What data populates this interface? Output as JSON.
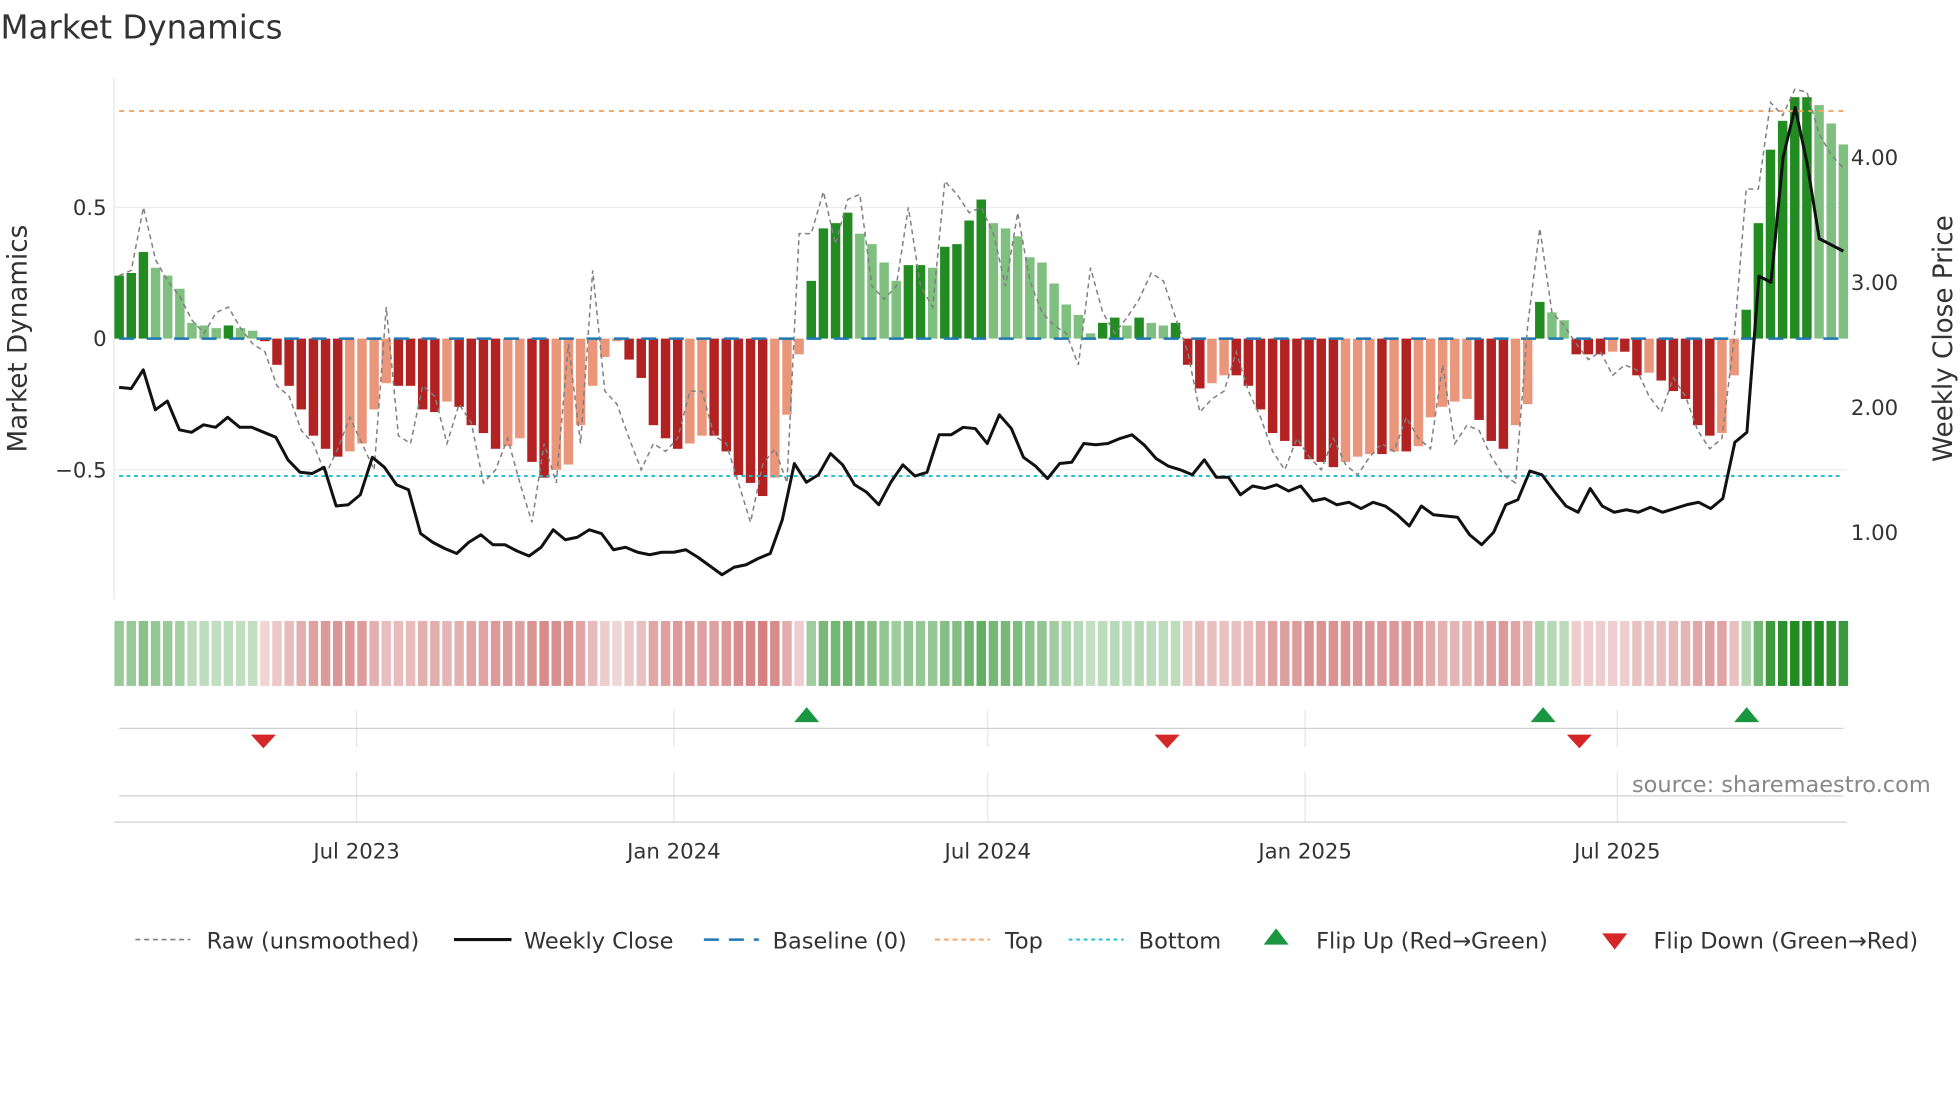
{
  "chart_data": {
    "type": "bar",
    "title": "Market Dynamics",
    "ylabel": "Market Dynamics",
    "y2label": "Weekly Close Price",
    "ylim": [
      -0.99,
      0.99
    ],
    "y2lim": [
      0.55,
      4.7
    ],
    "yticks": [
      {
        "v": 0.5,
        "label": "0.5"
      },
      {
        "v": 0,
        "label": "0"
      },
      {
        "v": -0.5,
        "label": "−0.5"
      }
    ],
    "y2ticks": [
      {
        "v": 4,
        "label": "4.00"
      },
      {
        "v": 3,
        "label": "3.00"
      },
      {
        "v": 2,
        "label": "2.00"
      },
      {
        "v": 1,
        "label": "1.00"
      }
    ],
    "x_start": "2023-02-13",
    "x_end": "2025-11-10",
    "xticks": [
      {
        "date": "2023-07-01",
        "label": "Jul 2023"
      },
      {
        "date": "2024-01-01",
        "label": "Jan 2024"
      },
      {
        "date": "2024-07-01",
        "label": "Jul 2024"
      },
      {
        "date": "2025-01-01",
        "label": "Jan 2025"
      },
      {
        "date": "2025-07-01",
        "label": "Jul 2025"
      }
    ],
    "levels": {
      "top": 0.867,
      "bottom": -0.524,
      "baseline": 0
    },
    "dynamics": [
      0.24,
      0.25,
      0.33,
      0.27,
      0.24,
      0.19,
      0.06,
      0.05,
      0.04,
      0.05,
      0.04,
      0.03,
      -0.01,
      -0.1,
      -0.18,
      -0.27,
      -0.37,
      -0.42,
      -0.45,
      -0.43,
      -0.4,
      -0.27,
      -0.17,
      -0.18,
      -0.18,
      -0.27,
      -0.28,
      -0.24,
      -0.26,
      -0.33,
      -0.36,
      -0.42,
      -0.41,
      -0.38,
      -0.47,
      -0.53,
      -0.5,
      -0.48,
      -0.33,
      -0.18,
      -0.07,
      -0.01,
      -0.08,
      -0.15,
      -0.33,
      -0.38,
      -0.42,
      -0.4,
      -0.37,
      -0.37,
      -0.43,
      -0.52,
      -0.55,
      -0.6,
      -0.53,
      -0.29,
      -0.06,
      0.22,
      0.42,
      0.44,
      0.48,
      0.4,
      0.36,
      0.29,
      0.22,
      0.28,
      0.28,
      0.27,
      0.35,
      0.36,
      0.45,
      0.53,
      0.44,
      0.42,
      0.39,
      0.31,
      0.29,
      0.21,
      0.13,
      0.09,
      0.02,
      0.06,
      0.08,
      0.05,
      0.08,
      0.06,
      0.05,
      0.06,
      -0.1,
      -0.19,
      -0.17,
      -0.14,
      -0.14,
      -0.18,
      -0.27,
      -0.36,
      -0.39,
      -0.41,
      -0.46,
      -0.47,
      -0.49,
      -0.47,
      -0.45,
      -0.44,
      -0.44,
      -0.43,
      -0.43,
      -0.41,
      -0.3,
      -0.26,
      -0.24,
      -0.23,
      -0.31,
      -0.39,
      -0.42,
      -0.33,
      -0.25,
      0.14,
      0.1,
      0.07,
      -0.06,
      -0.06,
      -0.06,
      -0.05,
      -0.05,
      -0.14,
      -0.13,
      -0.16,
      -0.2,
      -0.23,
      -0.33,
      -0.37,
      -0.36,
      -0.14,
      0.11,
      0.44,
      0.72,
      0.83,
      0.92,
      0.92,
      0.89,
      0.82,
      0.74
    ],
    "raw": [
      0.24,
      0.26,
      0.5,
      0.3,
      0.22,
      0.16,
      0.07,
      0.02,
      0.1,
      0.12,
      0.04,
      -0.02,
      -0.05,
      -0.18,
      -0.22,
      -0.35,
      -0.4,
      -0.52,
      -0.42,
      -0.3,
      -0.4,
      -0.5,
      0.12,
      -0.37,
      -0.4,
      -0.18,
      -0.22,
      -0.4,
      -0.25,
      -0.32,
      -0.55,
      -0.5,
      -0.38,
      -0.55,
      -0.7,
      -0.4,
      -0.55,
      -0.02,
      -0.4,
      0.26,
      -0.2,
      -0.25,
      -0.38,
      -0.5,
      -0.4,
      -0.43,
      -0.38,
      -0.2,
      -0.2,
      -0.37,
      -0.4,
      -0.55,
      -0.7,
      -0.48,
      -0.42,
      -0.55,
      0.4,
      0.4,
      0.56,
      0.36,
      0.53,
      0.55,
      0.2,
      0.15,
      0.2,
      0.5,
      0.2,
      0.12,
      0.6,
      0.55,
      0.48,
      0.5,
      0.4,
      0.2,
      0.48,
      0.22,
      0.1,
      0.05,
      0.02,
      -0.1,
      0.27,
      0.1,
      0.02,
      0.08,
      0.15,
      0.25,
      0.22,
      0.08,
      -0.05,
      -0.28,
      -0.23,
      -0.2,
      -0.05,
      -0.2,
      -0.3,
      -0.43,
      -0.5,
      -0.38,
      -0.45,
      -0.5,
      -0.38,
      -0.48,
      -0.52,
      -0.45,
      -0.4,
      -0.43,
      -0.3,
      -0.38,
      -0.42,
      -0.1,
      -0.4,
      -0.33,
      -0.35,
      -0.45,
      -0.52,
      -0.55,
      0.05,
      0.42,
      0.1,
      0.05,
      -0.02,
      -0.08,
      -0.05,
      -0.14,
      -0.1,
      -0.12,
      -0.22,
      -0.28,
      -0.15,
      -0.22,
      -0.35,
      -0.42,
      -0.38,
      0.0,
      0.57,
      0.57,
      0.9,
      0.85,
      0.95,
      0.94,
      0.78,
      0.7,
      0.65
    ],
    "weekly_close": [
      2.16,
      2.15,
      2.3,
      1.98,
      2.05,
      1.82,
      1.8,
      1.86,
      1.84,
      1.92,
      1.84,
      1.84,
      1.8,
      1.76,
      1.58,
      1.48,
      1.47,
      1.52,
      1.21,
      1.22,
      1.3,
      1.6,
      1.52,
      1.38,
      1.34,
      0.99,
      0.92,
      0.87,
      0.83,
      0.92,
      0.98,
      0.9,
      0.9,
      0.85,
      0.81,
      0.88,
      1.02,
      0.94,
      0.96,
      1.02,
      0.99,
      0.86,
      0.88,
      0.84,
      0.82,
      0.84,
      0.84,
      0.86,
      0.8,
      0.73,
      0.66,
      0.72,
      0.74,
      0.79,
      0.83,
      1.1,
      1.55,
      1.4,
      1.46,
      1.63,
      1.54,
      1.38,
      1.32,
      1.22,
      1.4,
      1.54,
      1.45,
      1.48,
      1.78,
      1.78,
      1.84,
      1.83,
      1.71,
      1.94,
      1.83,
      1.6,
      1.53,
      1.43,
      1.55,
      1.56,
      1.71,
      1.7,
      1.71,
      1.75,
      1.78,
      1.7,
      1.59,
      1.53,
      1.5,
      1.46,
      1.58,
      1.44,
      1.44,
      1.3,
      1.37,
      1.35,
      1.38,
      1.33,
      1.37,
      1.25,
      1.27,
      1.22,
      1.24,
      1.19,
      1.24,
      1.21,
      1.14,
      1.05,
      1.21,
      1.14,
      1.13,
      1.12,
      0.98,
      0.9,
      1.0,
      1.22,
      1.26,
      1.49,
      1.46,
      1.33,
      1.21,
      1.16,
      1.35,
      1.21,
      1.16,
      1.18,
      1.16,
      1.2,
      1.16,
      1.19,
      1.22,
      1.24,
      1.19,
      1.27,
      1.72,
      1.8,
      3.05,
      3.0,
      4.0,
      4.4,
      3.95,
      3.35,
      3.3,
      3.25
    ],
    "flips": [
      {
        "type": "down",
        "date": "2023-05-08"
      },
      {
        "type": "up",
        "date": "2024-03-18"
      },
      {
        "type": "down",
        "date": "2024-10-13"
      },
      {
        "type": "up",
        "date": "2025-05-19"
      },
      {
        "type": "down",
        "date": "2025-06-09"
      },
      {
        "type": "up",
        "date": "2025-09-14"
      }
    ],
    "legend": {
      "placement": "bottom",
      "raw": "Raw (unsmoothed)",
      "close": "Weekly Close",
      "baseline": "Baseline (0)",
      "top": "Top",
      "bottom": "Bottom",
      "flip_up": "Flip Up (Red→Green)",
      "flip_down": "Flip Down (Green→Red)"
    },
    "source": "source: sharemaestro.com"
  },
  "colors": {
    "up_strong": "#228b22",
    "up_weak": "#7fbf7f",
    "down_strong": "#b22222",
    "down_weak": "#e9967a",
    "baseline": "#1f77b4",
    "top": "#f4a460",
    "bottom": "#17becf",
    "flip_up": "#1a9641",
    "flip_down": "#d62728"
  }
}
